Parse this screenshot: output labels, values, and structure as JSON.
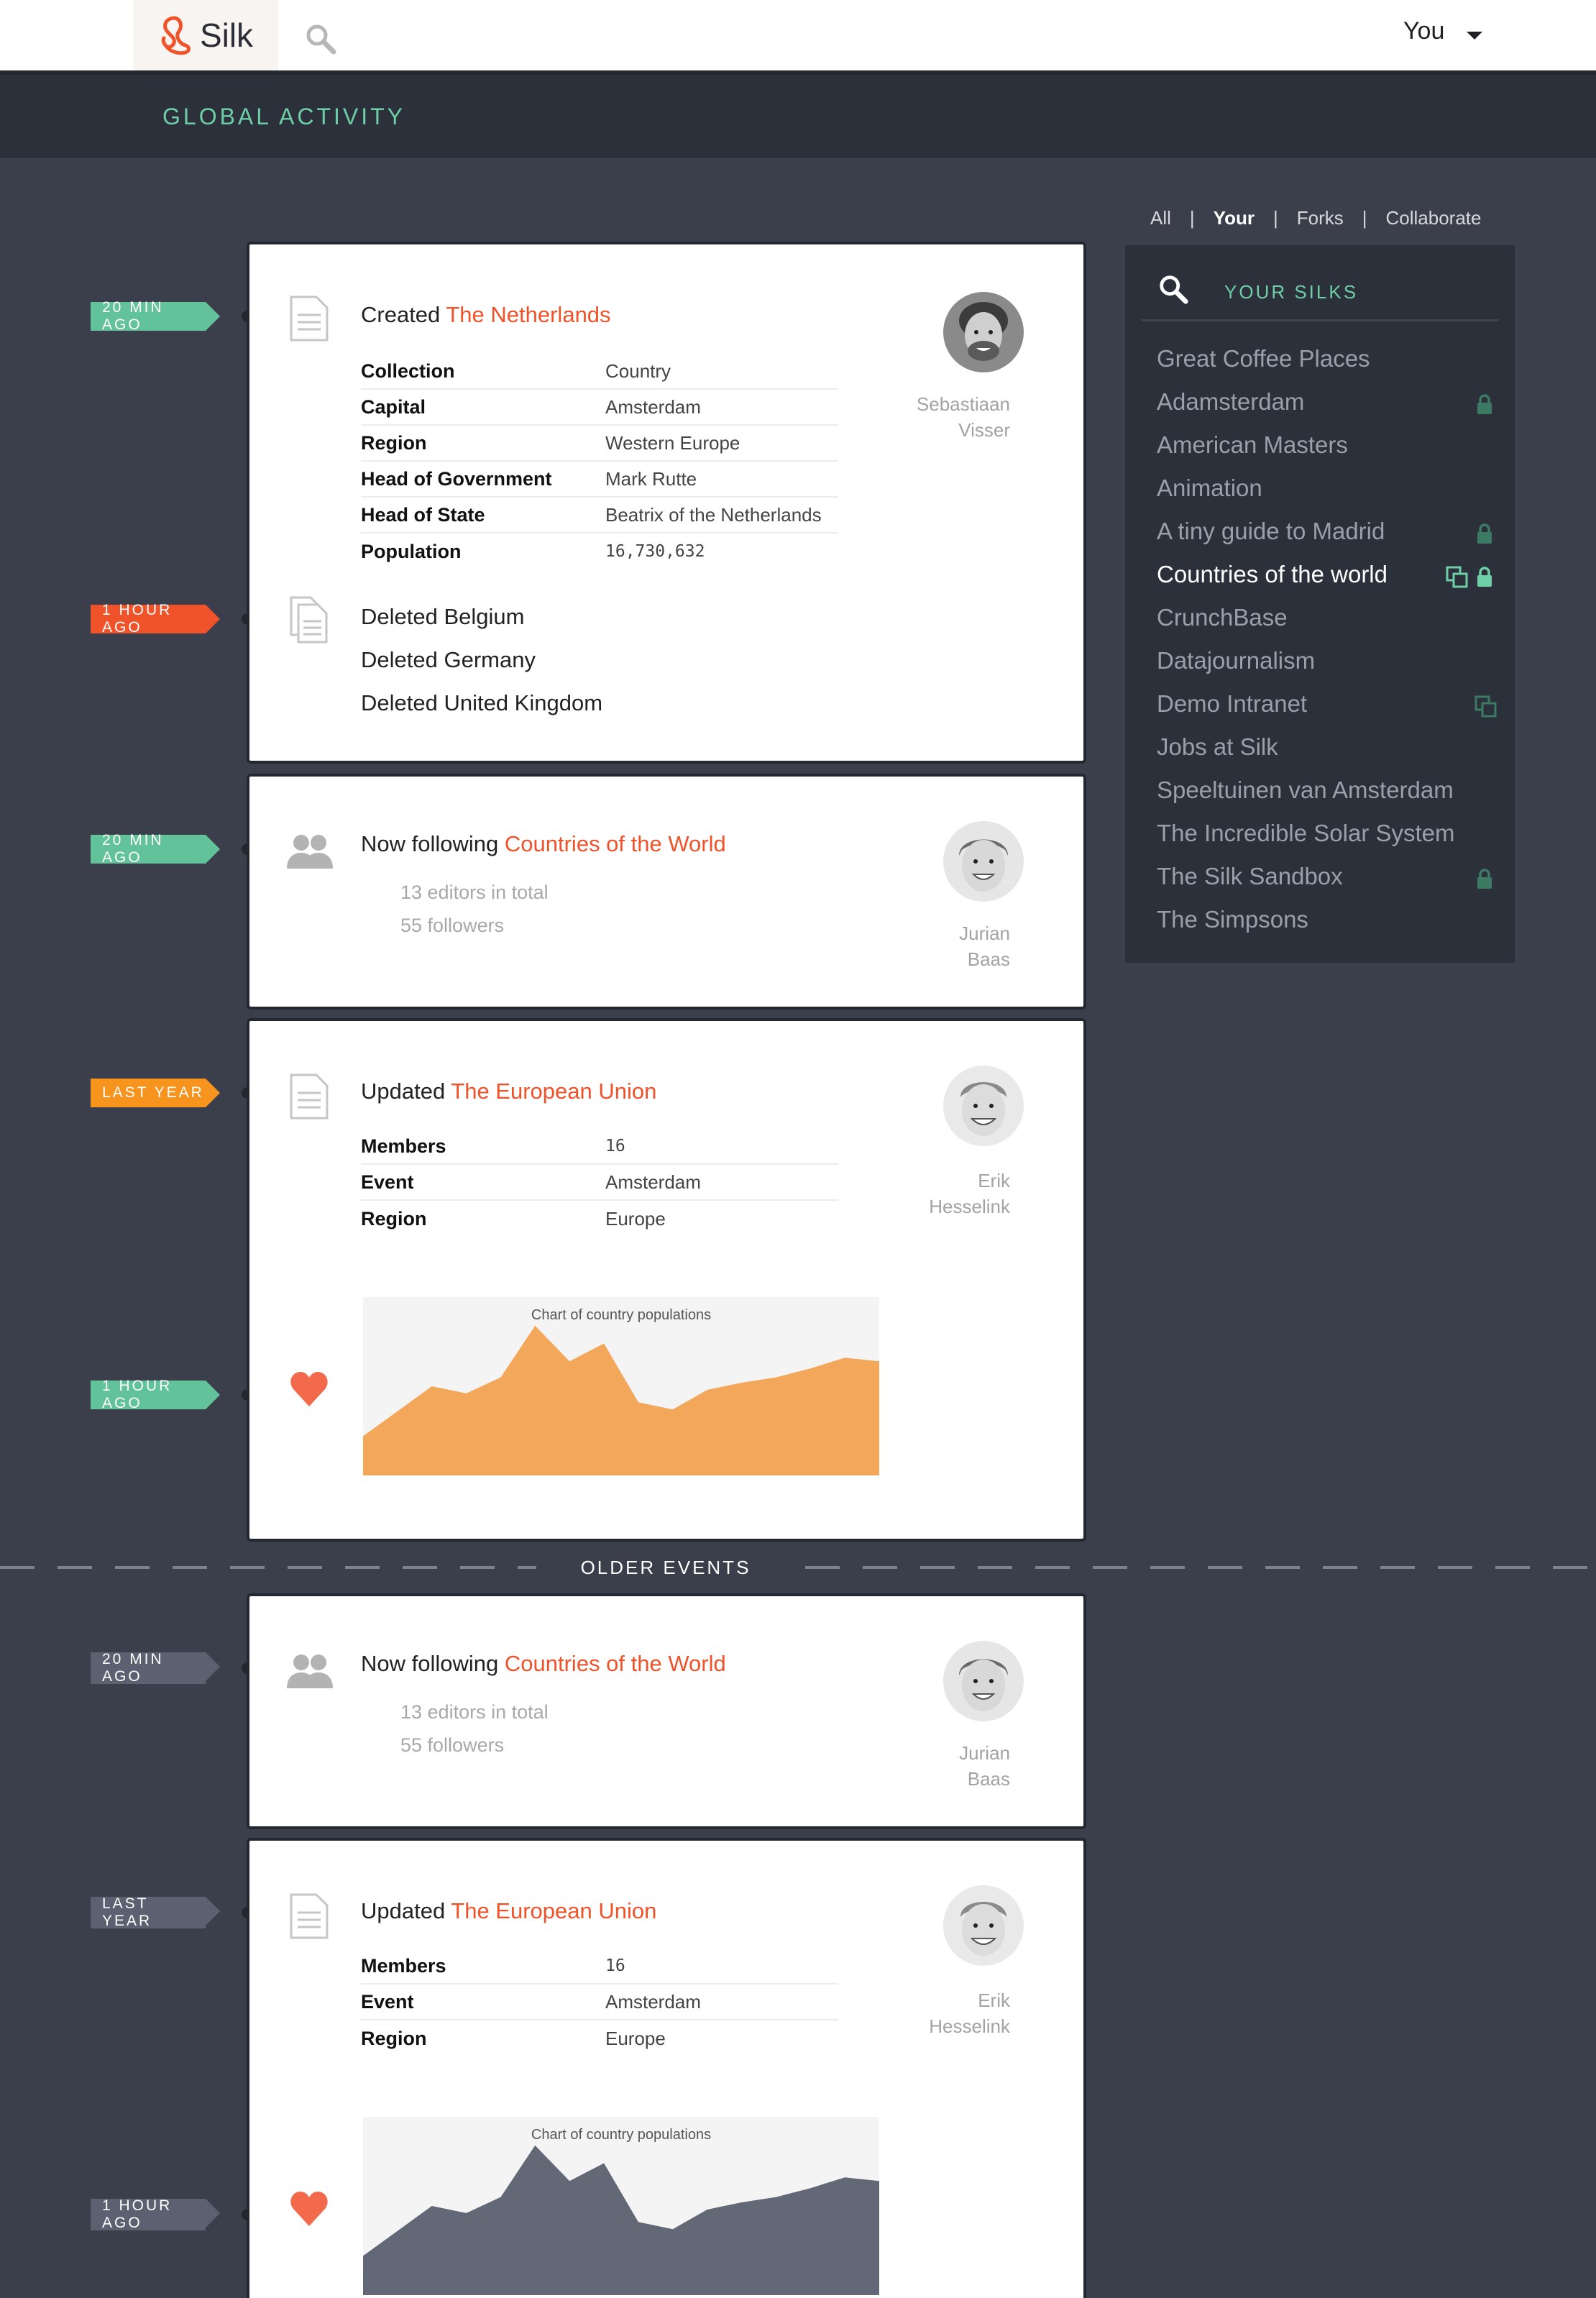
{
  "topbar": {
    "brand": "Silk",
    "user": "You"
  },
  "subbar": {
    "title": "GLOBAL ACTIVITY"
  },
  "filters": {
    "all": "All",
    "your": "Your",
    "forks": "Forks",
    "collaborate": "Collaborate",
    "separator": "|"
  },
  "sidebar": {
    "title": "YOUR SILKS",
    "items": [
      {
        "label": "Great Coffee Places"
      },
      {
        "label": "Adamsterdam"
      },
      {
        "label": "American Masters"
      },
      {
        "label": "Animation"
      },
      {
        "label": "A tiny guide to Madrid"
      },
      {
        "label": "Countries of the world"
      },
      {
        "label": "CrunchBase"
      },
      {
        "label": "Datajournalism"
      },
      {
        "label": "Demo Intranet"
      },
      {
        "label": "Jobs at Silk"
      },
      {
        "label": "Speeltuinen van Amsterdam"
      },
      {
        "label": "The Incredible Solar System"
      },
      {
        "label": "The Silk Sandbox"
      },
      {
        "label": "The Simpsons"
      }
    ]
  },
  "events": {
    "e1": {
      "time": "20 MIN AGO",
      "verb": "Created",
      "target": "The Netherlands",
      "author_first": "Sebastiaan",
      "author_last": "Visser",
      "rows": [
        {
          "key": "Collection",
          "value": "Country"
        },
        {
          "key": "Capital",
          "value": "Amsterdam"
        },
        {
          "key": "Region",
          "value": "Western Europe"
        },
        {
          "key": "Head of Government",
          "value": "Mark Rutte"
        },
        {
          "key": "Head of State",
          "value": "Beatrix of the Netherlands"
        },
        {
          "key": "Population",
          "value": "16,730,632"
        }
      ]
    },
    "e2": {
      "time": "1 HOUR AGO",
      "deleted": [
        "Deleted Belgium",
        "Deleted Germany",
        "Deleted United Kingdom"
      ]
    },
    "e3": {
      "time": "20 MIN AGO",
      "verb": "Now following",
      "target": "Countries of the World",
      "editors": "13 editors in total",
      "followers": "55 followers",
      "author_first": "Jurian",
      "author_last": "Baas"
    },
    "e4": {
      "time": "LAST YEAR",
      "verb": "Updated",
      "target": "The European Union",
      "author_first": "Erik",
      "author_last": "Hesselink",
      "rows": [
        {
          "key": "Members",
          "value": "16"
        },
        {
          "key": "Event",
          "value": "Amsterdam"
        },
        {
          "key": "Region",
          "value": "Europe"
        }
      ]
    },
    "e5": {
      "time": "1 HOUR AGO",
      "chart_title": "Chart of country populations"
    },
    "divider": "OLDER EVENTS",
    "e6": {
      "time": "20 MIN AGO",
      "verb": "Now following",
      "target": "Countries of the World",
      "editors": "13 editors in total",
      "followers": "55 followers",
      "author_first": "Jurian",
      "author_last": "Baas"
    },
    "e7": {
      "time": "LAST YEAR",
      "verb": "Updated",
      "target": "The European Union",
      "author_first": "Erik",
      "author_last": "Hesselink",
      "rows": [
        {
          "key": "Members",
          "value": "16"
        },
        {
          "key": "Event",
          "value": "Amsterdam"
        },
        {
          "key": "Region",
          "value": "Europe"
        }
      ]
    },
    "e8": {
      "time": "1 HOUR AGO",
      "chart_title": "Chart of country populations"
    }
  },
  "chart_data": [
    {
      "type": "area",
      "title": "Chart of country populations",
      "x": [
        0,
        1,
        2,
        3,
        4,
        5,
        6,
        7,
        8,
        9,
        10,
        11,
        12,
        13,
        14,
        15
      ],
      "values": [
        22,
        36,
        50,
        46,
        55,
        84,
        64,
        74,
        41,
        37,
        48,
        52,
        55,
        60,
        66,
        64
      ],
      "ylim": [
        0,
        100
      ],
      "color": "#f2a75a",
      "grid": false
    },
    {
      "type": "area",
      "title": "Chart of country populations",
      "x": [
        0,
        1,
        2,
        3,
        4,
        5,
        6,
        7,
        8,
        9,
        10,
        11,
        12,
        13,
        14,
        15
      ],
      "values": [
        22,
        36,
        50,
        46,
        55,
        84,
        64,
        74,
        41,
        37,
        48,
        52,
        55,
        60,
        66,
        64
      ],
      "ylim": [
        0,
        100
      ],
      "color": "#636876",
      "grid": false
    }
  ],
  "colors": {
    "accent": "#f0522a",
    "green": "#62c39a",
    "orange": "#f7941e",
    "dark": "#2b303a",
    "background": "#3a3f4b"
  }
}
